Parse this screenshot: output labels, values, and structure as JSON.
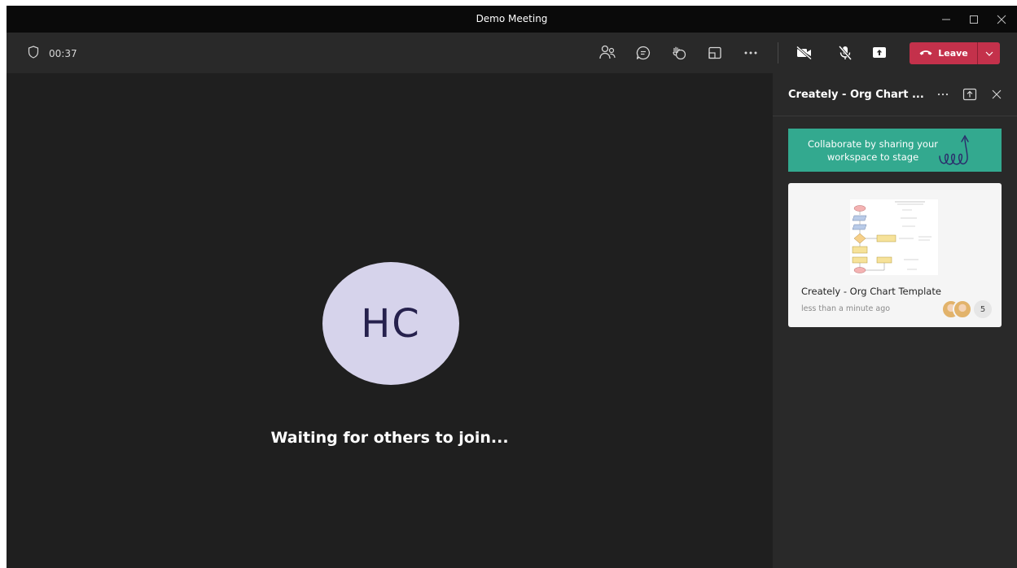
{
  "window": {
    "title": "Demo Meeting",
    "controls": {
      "minimize": "minimize-icon",
      "maximize": "maximize-icon",
      "close": "close-icon"
    }
  },
  "toolbar": {
    "timer": "00:37",
    "icons": [
      "shield-icon",
      "people-icon",
      "chat-icon",
      "raise-hand-icon",
      "rooms-icon",
      "more-icon",
      "camera-off-icon",
      "mic-off-icon",
      "share-icon"
    ],
    "leave_label": "Leave",
    "leave_color": "#c4314b"
  },
  "stage": {
    "avatar_initials": "HC",
    "avatar_bg": "#d6d3eb",
    "waiting_text": "Waiting for others to join..."
  },
  "side_panel": {
    "title": "Creately - Org Chart ...",
    "banner_text": "Collaborate by sharing your workspace to stage",
    "banner_color": "#33a98f",
    "card": {
      "title": "Creately - Org Chart Template",
      "time": "less than a minute ago",
      "collaborator_count": "5"
    }
  }
}
